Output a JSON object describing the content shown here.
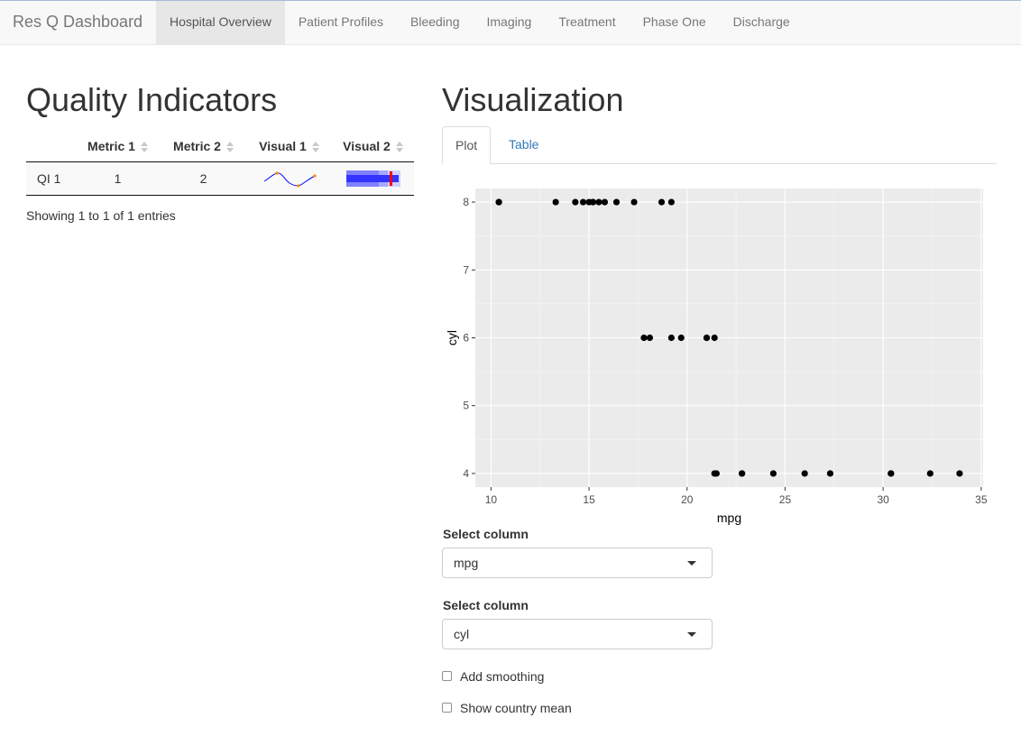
{
  "navbar": {
    "brand": "Res Q Dashboard",
    "items": [
      "Hospital Overview",
      "Patient Profiles",
      "Bleeding",
      "Imaging",
      "Treatment",
      "Phase One",
      "Discharge"
    ],
    "active_index": 0
  },
  "quality_indicators": {
    "title": "Quality Indicators",
    "columns": [
      "",
      "Metric 1",
      "Metric 2",
      "Visual 1",
      "Visual 2"
    ],
    "rows": [
      {
        "label": "QI 1",
        "metric1": "1",
        "metric2": "2"
      }
    ],
    "info": "Showing 1 to 1 of 1 entries"
  },
  "visualization": {
    "title": "Visualization",
    "tabs": [
      "Plot",
      "Table"
    ],
    "active_tab": "Plot"
  },
  "controls": {
    "x_label": "Select column",
    "x_value": "mpg",
    "y_label": "Select column",
    "y_value": "cyl",
    "smoothing_label": "Add smoothing",
    "smoothing_checked": false,
    "country_mean_label": "Show country mean",
    "country_mean_checked": false
  },
  "colors": {
    "panel_bg": "#ebebeb",
    "grid": "#ffffff",
    "point": "#000000",
    "link": "#337ab7",
    "sparkline": "#0000ff",
    "sparkline_marker": "#ff8c00",
    "bullet_bar": "#3333ff",
    "bullet_target": "#ff0000"
  },
  "chart_data": {
    "type": "scatter",
    "xlabel": "mpg",
    "ylabel": "cyl",
    "xlim": [
      9.2,
      35.1
    ],
    "ylim": [
      3.8,
      8.2
    ],
    "xticks": [
      10,
      15,
      20,
      25,
      30,
      35
    ],
    "yticks": [
      4,
      5,
      6,
      7,
      8
    ],
    "points": [
      [
        21.0,
        6
      ],
      [
        21.0,
        6
      ],
      [
        22.8,
        4
      ],
      [
        21.4,
        6
      ],
      [
        18.7,
        8
      ],
      [
        18.1,
        6
      ],
      [
        14.3,
        8
      ],
      [
        24.4,
        4
      ],
      [
        22.8,
        4
      ],
      [
        19.2,
        6
      ],
      [
        17.8,
        6
      ],
      [
        16.4,
        8
      ],
      [
        17.3,
        8
      ],
      [
        15.2,
        8
      ],
      [
        10.4,
        8
      ],
      [
        10.4,
        8
      ],
      [
        14.7,
        8
      ],
      [
        32.4,
        4
      ],
      [
        30.4,
        4
      ],
      [
        33.9,
        4
      ],
      [
        21.5,
        4
      ],
      [
        15.5,
        8
      ],
      [
        15.2,
        8
      ],
      [
        13.3,
        8
      ],
      [
        19.2,
        8
      ],
      [
        27.3,
        4
      ],
      [
        26.0,
        4
      ],
      [
        30.4,
        4
      ],
      [
        15.8,
        8
      ],
      [
        19.7,
        6
      ],
      [
        15.0,
        8
      ],
      [
        21.4,
        4
      ]
    ]
  }
}
